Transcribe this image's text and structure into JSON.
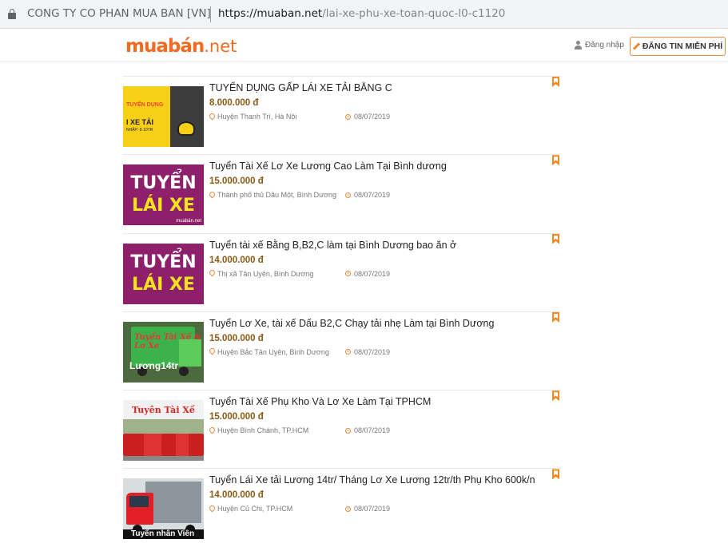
{
  "browser": {
    "site_owner": "CONG TY CO PHAN MUA BAN [VN]",
    "url_host": "https://muaban.net",
    "url_path": "/lai-xe-phu-xe-toan-quoc-l0-c1120"
  },
  "header": {
    "logo_brand": "muabán",
    "logo_tld": ".net",
    "login_label": "Đăng nhập",
    "post_button_label": "ĐĂNG TIN MIỄN PHÍ"
  },
  "colors": {
    "brand_orange": "#f26a21",
    "price_brown": "#8a5a14",
    "bookmark_orange": "#f08a24"
  },
  "listings": [
    {
      "title": "TUYỂN DỤNG GẤP LÁI XE TẢI BẰNG C",
      "price": "8.000.000 đ",
      "location": "Huyện Thanh Trì, Hà Nội",
      "date": "08/07/2019",
      "thumb": {
        "line1": "TUYỂN DỤNG",
        "line2": "I XE TẢI",
        "line3": "NHẬP: 8-10TR"
      }
    },
    {
      "title": "Tuyển Tài Xế Lơ Xe Lương Cao Làm Tại Bình dương",
      "price": "15.000.000 đ",
      "location": "Thành phố thủ Dầu Một, Bình Dương",
      "date": "08/07/2019",
      "thumb": {
        "line1": "TUYỂN",
        "line2": "LÁI XE",
        "watermark": "muabán.net"
      }
    },
    {
      "title": "Tuyển tài xế Bằng B,B2,C làm tại Bình Dương bao ăn ở",
      "price": "14.000.000 đ",
      "location": "Thị xã Tân Uyên, Bình Dương",
      "date": "08/07/2019",
      "thumb": {
        "line1": "TUYỂN",
        "line2": "LÁI XE"
      }
    },
    {
      "title": "Tuyển Lơ Xe, tài xế Dấu B2,C Chạy tải nhẹ Làm tại Bình Dương",
      "price": "15.000.000 đ",
      "location": "Huyện Bắc Tân Uyên, Bình Dương",
      "date": "08/07/2019",
      "thumb": {
        "line1": "Tuyển Tài Xế & Lơ Xe",
        "line2": "Lương14tr"
      }
    },
    {
      "title": "Tuyển Tài Xế Phụ Kho Và Lơ Xe Làm Tại TPHCM",
      "price": "15.000.000 đ",
      "location": "Huyện Bình Chánh, TP.HCM",
      "date": "08/07/2019",
      "thumb": {
        "line1": "Tuyên Tài Xế"
      }
    },
    {
      "title": "Tuyển Lái Xe tải Lương 14tr/ Tháng Lơ Xe Lương 12tr/th Phụ Kho 600k/n",
      "price": "14.000.000 đ",
      "location": "Huyện Củ Chi, TP.HCM",
      "date": "08/07/2019",
      "thumb": {
        "line1": "Tuyển nhân Viên"
      }
    }
  ]
}
